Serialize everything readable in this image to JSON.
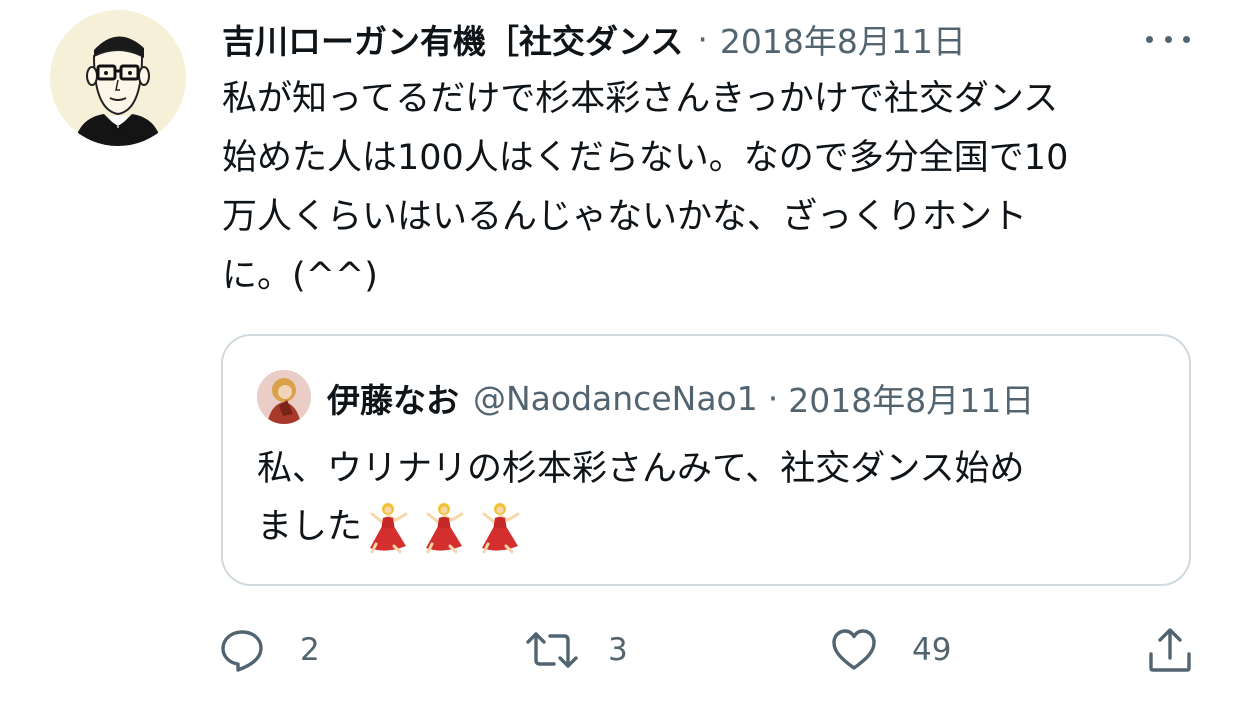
{
  "tweet": {
    "author_name": "吉川ローガン有機［社交ダンス",
    "separator": "·",
    "date": "2018年8月11日",
    "text_lines": [
      "私が知ってるだけで杉本彩さんきっかけで社交ダンス",
      "始めた人は100人はくだらない。なので多分全国で10",
      "万人くらいはいるんじゃないかな、ざっくりホント",
      "に。(^^)"
    ]
  },
  "quote": {
    "name": "伊藤なお",
    "handle": "@NaodanceNao1",
    "separator": "·",
    "date": "2018年8月11日",
    "line1": "私、ウリナリの杉本彩さんみて、社交ダンス始め",
    "line2_text": "ました",
    "emoji_icons": [
      "dancer-emoji-icon",
      "dancer-emoji-icon",
      "dancer-emoji-icon"
    ]
  },
  "actions": {
    "reply_count": "2",
    "retweet_count": "3",
    "like_count": "49"
  },
  "colors": {
    "text": "#0f1419",
    "secondary": "#536471",
    "border": "#cfd9de"
  }
}
